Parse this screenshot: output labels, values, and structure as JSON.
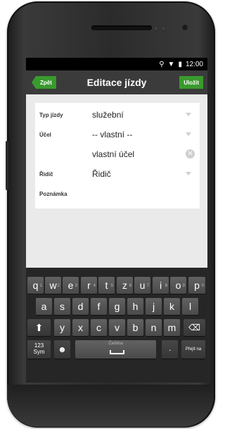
{
  "status": {
    "time": "12:00"
  },
  "actionbar": {
    "back_label": "Zpět",
    "title": "Editace jízdy",
    "save_label": "Uložit"
  },
  "form": {
    "fields": [
      {
        "label": "Typ jízdy",
        "value": "služební"
      },
      {
        "label": "Účel",
        "value": "-- vlastní --"
      },
      {
        "label": "",
        "value": "vlastní účel"
      },
      {
        "label": "Řidič",
        "value": "Řidič"
      },
      {
        "label": "Poznámka",
        "value": ""
      }
    ]
  },
  "keyboard": {
    "row1": [
      "q",
      "w",
      "e",
      "r",
      "t",
      "z",
      "u",
      "i",
      "o",
      "p"
    ],
    "row1_sup": [
      "1",
      "2",
      "3",
      "4",
      "5",
      "6",
      "7",
      "8",
      "9",
      "0"
    ],
    "row2": [
      "a",
      "s",
      "d",
      "f",
      "g",
      "h",
      "j",
      "k",
      "l"
    ],
    "row3": [
      "y",
      "x",
      "c",
      "v",
      "b",
      "n",
      "m"
    ],
    "symbols_label": "123\nSym",
    "space_label": "Čeština",
    "enter_label": "Přejít na"
  },
  "icons": [
    "location-icon",
    "wifi-icon",
    "battery-icon",
    "shift-icon",
    "backspace-icon",
    "emoji-icon"
  ]
}
